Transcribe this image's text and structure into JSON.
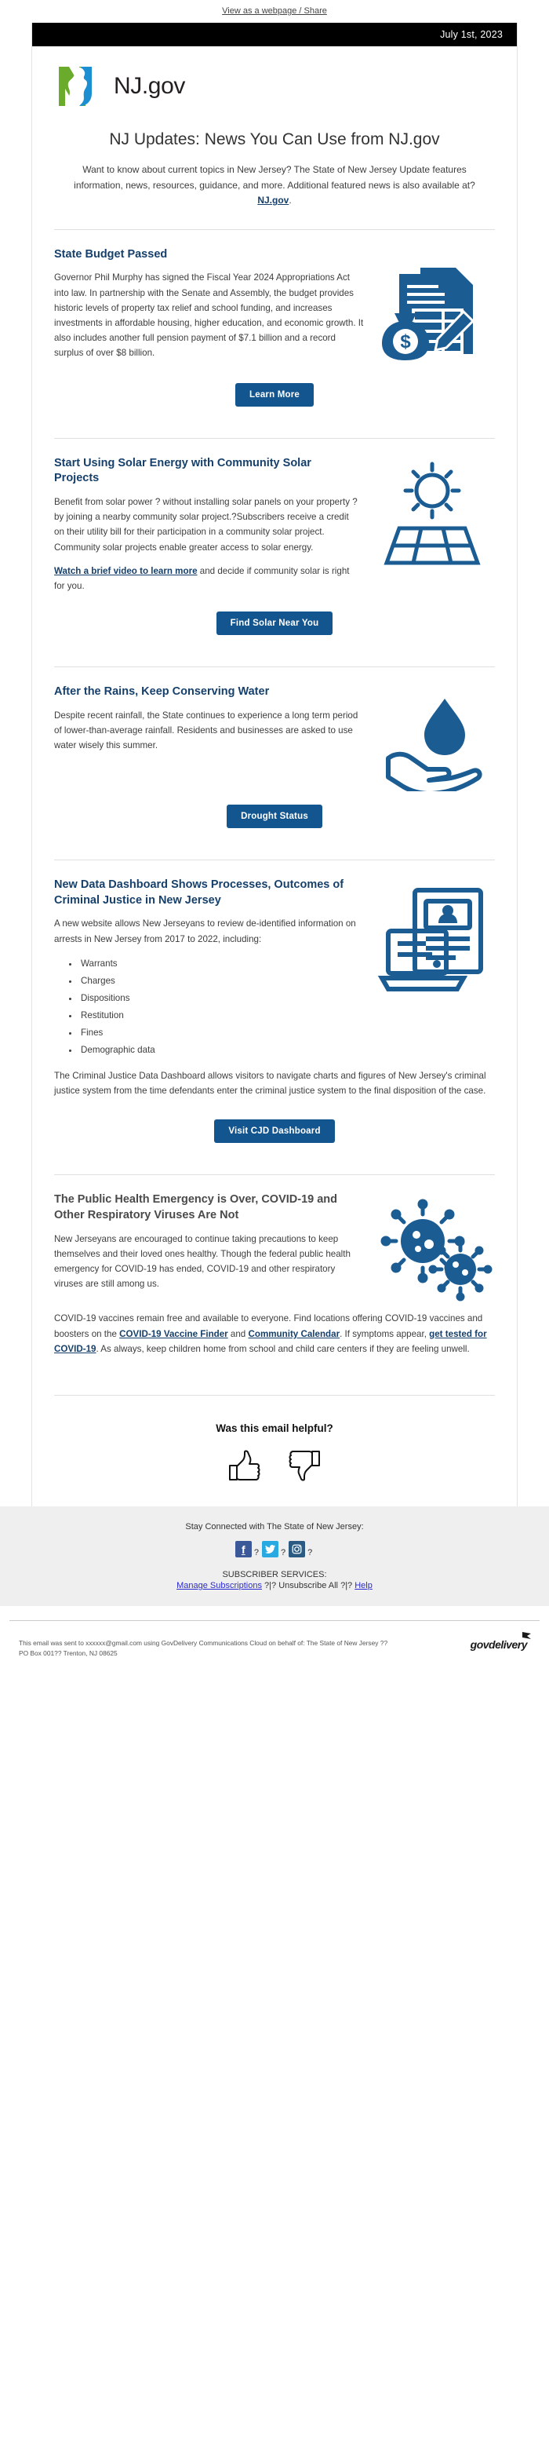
{
  "preheader": {
    "text": "View as a webpage / Share"
  },
  "header": {
    "date": "July 1st, 2023",
    "logo_text": "NJ.gov",
    "logo_icon": "nj-state-logo"
  },
  "masthead": {
    "title": "NJ Updates: News You Can Use from NJ.gov",
    "intro_1": "Want to know about current topics in New Jersey? The State of New Jersey Update features information, news, resources, guidance, and more. Additional featured news is also available at?",
    "intro_link": "NJ.gov",
    "intro_end": "."
  },
  "stories": [
    {
      "id": "state-budget",
      "heading": "State Budget Passed",
      "heading_color": "#16406b",
      "body": "Governor Phil Murphy has signed the Fiscal Year 2024 Appropriations Act into law. In partnership with the Senate and Assembly, the budget provides historic levels of property tax relief and school funding, and increases investments in affordable housing, higher education, and economic growth. It also includes another full pension payment of $7.1 billion and a record surplus of over $8 billion.",
      "button": "Learn More",
      "art": "budget-documents-money-icon"
    },
    {
      "id": "community-solar",
      "heading": "Start Using Solar Energy with Community Solar Projects",
      "heading_color": "#16406b",
      "body": "Benefit from solar power ? without installing solar panels on your property ? by joining a nearby community solar project.?Subscribers receive a credit on their utility bill for their participation in a community solar project. Community solar projects enable greater access to solar energy.",
      "link_text": "Watch a brief video to learn more",
      "body_after_link": " and decide if community solar is right for you.",
      "button": "Find Solar Near You",
      "art": "sun-solar-panel-icon"
    },
    {
      "id": "water-conservation",
      "heading": "After the Rains, Keep Conserving Water",
      "heading_color": "#16406b",
      "body": "Despite recent rainfall, the State continues to experience a long term period of lower-than-average rainfall. Residents and businesses are asked to use water wisely this summer.",
      "button": "Drought Status",
      "art": "hand-water-drop-icon"
    },
    {
      "id": "criminal-justice-dashboard",
      "heading": "New Data Dashboard Shows Processes, Outcomes of Criminal Justice in New Jersey",
      "heading_color": "#16406b",
      "body": "A new website allows New Jerseyans to review de-identified information on arrests in New Jersey from 2017 to 2022, including:",
      "bullets": [
        "Warrants",
        "Charges",
        "Dispositions",
        "Restitution",
        "Fines",
        "Demographic data"
      ],
      "body_2": "The Criminal Justice Data Dashboard allows visitors to navigate charts and figures of New Jersey's criminal justice system from the time defendants enter the criminal justice system to the final disposition of the case.",
      "button": "Visit CJD Dashboard",
      "art": "laptop-data-dashboard-icon"
    },
    {
      "id": "public-health-emergency",
      "heading": "The Public Health Emergency is Over, COVID-19 and Other Respiratory Viruses Are Not",
      "heading_color": "#4a4a4a",
      "body": "New Jerseyans are encouraged to continue taking precautions to keep themselves and their loved ones healthy. Though the federal public health emergency for COVID-19 has ended, COVID-19 and other respiratory viruses are still among us.",
      "body_2_a": "COVID-19 vaccines remain free and available to everyone. Find locations offering COVID-19 vaccines and boosters on the ",
      "link_1": "COVID-19 Vaccine Finder",
      "body_2_b": " and ",
      "link_2": "Community Calendar",
      "body_2_c": ". If symptoms appear, ",
      "link_3": "get tested for COVID-19",
      "body_2_d": ". As always, keep children home from school and child care centers if they are feeling unwell.",
      "art": "coronavirus-icon"
    }
  ],
  "feedback": {
    "question": "Was this email helpful?",
    "thumbs_up_icon": "thumbs-up-icon",
    "thumbs_down_icon": "thumbs-down-icon"
  },
  "footer": {
    "stay_connected": "Stay Connected with The State of New Jersey:",
    "social": [
      {
        "name": "facebook",
        "glyph": "f",
        "color": "#3b5998"
      },
      {
        "name": "twitter",
        "glyph": "",
        "color": "#29a9e1"
      },
      {
        "name": "instagram",
        "glyph": "",
        "color": "#2b5b82"
      }
    ],
    "social_separator": "?",
    "subscriber_title": "SUBSCRIBER SERVICES:",
    "manage_link": "Manage Subscriptions",
    "sep_1": " ?|? ",
    "unsubscribe_link": "Unsubscribe All",
    "sep_2": " ?|? ",
    "help_link": "Help",
    "legal_line_1": "This email was sent to xxxxxx@gmail.com using GovDelivery Communications Cloud on behalf of: The State of New Jersey ??",
    "legal_line_2": "PO Box 001?? Trenton, NJ 08625",
    "govdelivery_logo": "govdelivery"
  },
  "colors": {
    "accent_blue": "#16406b",
    "button_blue": "#12558f",
    "art_blue": "#1b5c93",
    "logo_green": "#6aab2b",
    "logo_blue": "#1b8fd1",
    "black_bar": "#000000",
    "footer_gray": "#efefef"
  }
}
